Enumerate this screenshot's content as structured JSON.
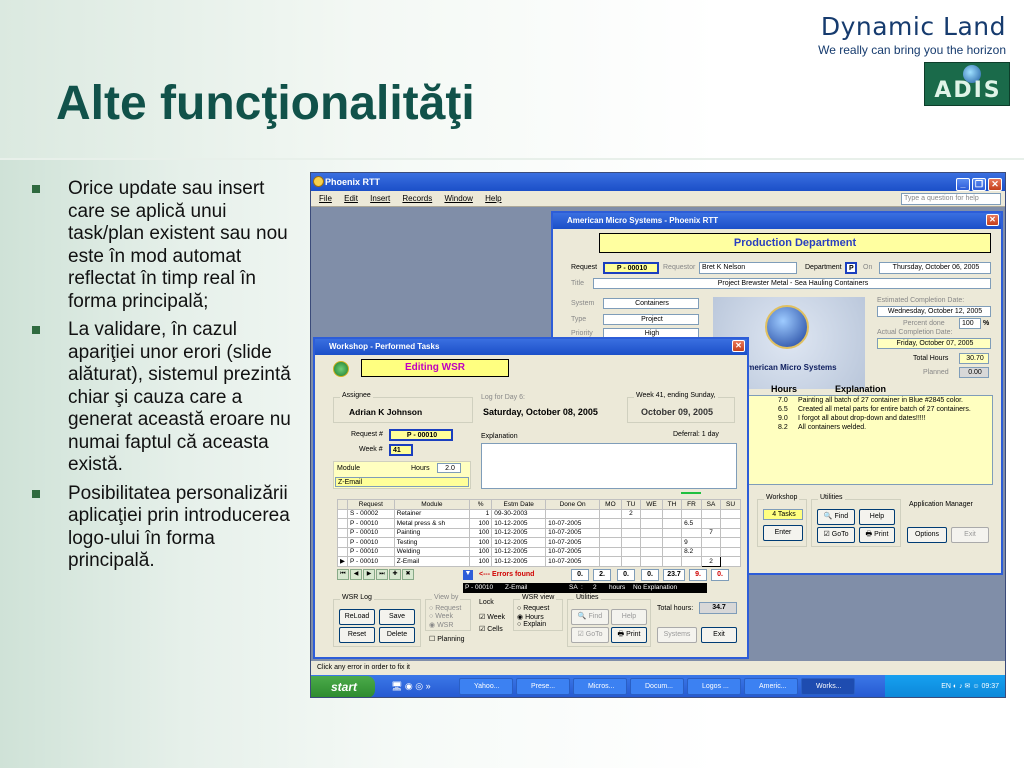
{
  "slide": {
    "title": "Alte funcţionalităţi",
    "brand_name": "Dynamic Land",
    "brand_tagline": "We really can bring you the horizon",
    "logo_text": "ADIS",
    "bullets": [
      "Orice update sau insert care se aplică unui task/plan existent sau nou este în mod automat reflectat în timp real în forma principală;",
      "La validare, în cazul apariţiei unor erori (slide alăturat), sistemul prezintă chiar şi cauza care a generat această eroare nu numai faptul că aceasta există.",
      "Posibilitatea personalizării aplicaţiei prin introducerea logo-ului în forma principală."
    ],
    "accent_color": "#11524a"
  },
  "app": {
    "title": "Phoenix RTT",
    "menu": [
      "File",
      "Edit",
      "Insert",
      "Records",
      "Window",
      "Help"
    ],
    "help_placeholder": "Type a question for help",
    "status_text": "Click any error in order to fix it",
    "taskbar": {
      "start": "start",
      "tasks": [
        "Yahoo...",
        "Prese...",
        "Micros...",
        "Docum...",
        "Logos ...",
        "Americ...",
        "Works..."
      ],
      "lang": "EN",
      "clock": "09:37"
    }
  },
  "ams": {
    "title": "American Micro Systems - Phoenix RTT",
    "department_banner": "Production Department",
    "request_label": "Request",
    "request_value": "P - 00010",
    "requestor_label": "Requestor",
    "requestor_value": "Bret K Nelson",
    "department_label": "Department",
    "department_value": "P",
    "on_label": "On",
    "on_value": "Thursday, October 06, 2005",
    "title_label": "Title",
    "title_value": "Project Brewster Metal - Sea Hauling Containers",
    "system_label": "System",
    "system_value": "Containers",
    "type_label": "Type",
    "type_value": "Project",
    "priority_label": "Priority",
    "priority_value": "High",
    "est_label": "Estimated Completion Date:",
    "est_value": "Wednesday, October 12, 2005",
    "percent_label": "Percent done",
    "percent_value": "100",
    "percent_unit": "%",
    "act_label": "Actual Completion Date:",
    "act_value": "Friday, October 07, 2005",
    "total_hours_label": "Total Hours",
    "total_hours_value": "30.70",
    "planned_label": "Planned",
    "planned_value": "0.00",
    "logo_caption": "American Micro Systems",
    "hours_header": "Hours",
    "explanation_header": "Explanation",
    "entries": [
      {
        "hours": "7.0",
        "text": "Painting all batch of 27 container in Blue #2845 color."
      },
      {
        "hours": "6.5",
        "text": "Created all metal parts for entire batch of 27 containers."
      },
      {
        "hours": "9.0",
        "text": "I forgot all about drop-down and dates!!!!!"
      },
      {
        "hours": "8.2",
        "text": "All containers welded."
      }
    ],
    "workshop_label": "Workshop",
    "workshop_tasks": "4 Tasks",
    "enter_btn": "Enter",
    "utilities_label": "Utilities",
    "find_btn": "Find",
    "help_btn": "Help",
    "goto_btn": "GoTo",
    "print_btn": "Print",
    "appman_label": "Application Manager",
    "options_btn": "Options",
    "exit_btn": "Exit"
  },
  "wsr": {
    "title": "Workshop - Performed Tasks",
    "banner": "Editing WSR",
    "assignee_label": "Assignee",
    "assignee_value": "Adrian K Johnson",
    "log_label": "Log for Day 6:",
    "log_value": "Saturday, October 08, 2005",
    "week_label": "Week 41, ending Sunday,",
    "week_value": "October 09, 2005",
    "request_label": "Request #",
    "request_value": "P - 00010",
    "week_no_label": "Week #",
    "week_no_value": "41",
    "explanation_label": "Explanation",
    "deferral_label": "Deferral: 1 day",
    "module_label": "Module",
    "hours_label": "Hours",
    "hours_value": "2.0",
    "module_value": "Z-Email",
    "grid_headers": [
      "Request",
      "Module",
      "%",
      "Estm Date",
      "Done On",
      "MO",
      "TU",
      "WE",
      "TH",
      "FR",
      "SA",
      "SU"
    ],
    "grid_rows": [
      [
        "S - 00002",
        "Retainer",
        "1",
        "09-30-2003",
        "",
        "",
        "2",
        "",
        "",
        "",
        "",
        ""
      ],
      [
        "P - 00010",
        "Metal press & sh",
        "100",
        "10-12-2005",
        "10-07-2005",
        "",
        "",
        "",
        "",
        "6.5",
        "",
        ""
      ],
      [
        "P - 00010",
        "Painting",
        "100",
        "10-12-2005",
        "10-07-2005",
        "",
        "",
        "",
        "",
        "",
        "7",
        ""
      ],
      [
        "P - 00010",
        "Testing",
        "100",
        "10-12-2005",
        "10-07-2005",
        "",
        "",
        "",
        "",
        "9",
        "",
        ""
      ],
      [
        "P - 00010",
        "Welding",
        "100",
        "10-12-2005",
        "10-07-2005",
        "",
        "",
        "",
        "",
        "8.2",
        "",
        ""
      ],
      [
        "P - 00010",
        "Z-Email",
        "100",
        "10-12-2005",
        "10-07-2005",
        "",
        "",
        "",
        "",
        "",
        "2",
        ""
      ]
    ],
    "errors_label": "<--- Errors found",
    "error_row": [
      "P - 00010",
      "Z-Email",
      "SA",
      ":",
      "2",
      "hours",
      "No Explanation"
    ],
    "totals": [
      "0.",
      "2.",
      "0.",
      "0.",
      "23.7",
      "9.",
      "0."
    ],
    "wsrlog_label": "WSR Log",
    "reload_btn": "ReLoad",
    "save_btn": "Save",
    "reset_btn": "Reset",
    "delete_btn": "Delete",
    "viewby_label": "View by",
    "viewby_options": [
      "Request",
      "Week",
      "WSR"
    ],
    "planning_label": "Planning",
    "lock_label": "Lock",
    "lock_week": "Week",
    "lock_cells": "Cells",
    "wsrview_label": "WSR view",
    "wsrview_options": [
      "Request",
      "Hours",
      "Explain"
    ],
    "utilities_label": "Utilities",
    "find_btn": "Find",
    "help_btn": "Help",
    "goto_btn": "GoTo",
    "print_btn": "Print",
    "total_hours_label": "Total hours:",
    "total_hours_value": "34.7",
    "systems_btn": "Systems",
    "exit_btn": "Exit"
  }
}
